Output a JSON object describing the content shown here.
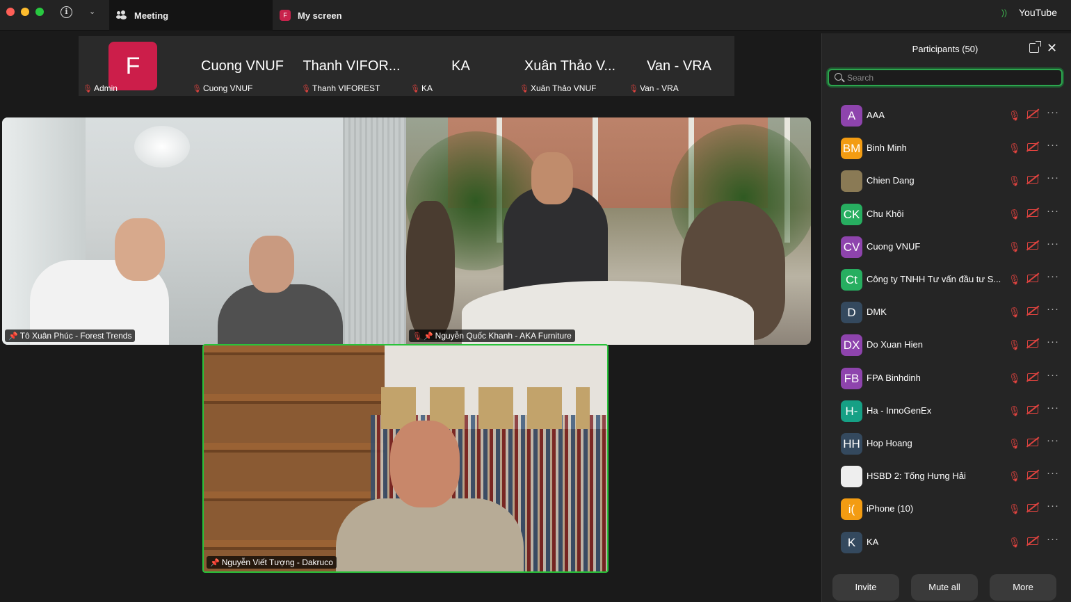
{
  "titlebar": {
    "tab_meeting": "Meeting",
    "tab_screen": "My screen",
    "tab_screen_badge": "F",
    "right_label": "YouTube"
  },
  "filmstrip": [
    {
      "big": "",
      "avatar": "F",
      "label": "Admin"
    },
    {
      "big": "Cuong VNUF",
      "label": "Cuong VNUF"
    },
    {
      "big": "Thanh VIFOR...",
      "label": "Thanh VIFOREST"
    },
    {
      "big": "KA",
      "label": "KA"
    },
    {
      "big": "Xuân Thảo V...",
      "label": "Xuân Thảo VNUF"
    },
    {
      "big": "Van - VRA",
      "label": "Van - VRA"
    }
  ],
  "tiles": {
    "t1": "Tô Xuân Phúc - Forest Trends",
    "t2": "Nguyễn Quốc Khanh - AKA Furniture",
    "t3": "Nguyễn Viết Tượng - Dakruco"
  },
  "panel": {
    "title": "Participants (50)",
    "search_placeholder": "Search",
    "participants": [
      {
        "initials": "A",
        "name": "AAA",
        "color": "#8e44ad"
      },
      {
        "initials": "BM",
        "name": "Binh Minh",
        "color": "#f39c12"
      },
      {
        "initials": "",
        "name": "Chien Dang",
        "color": "#8a7a55"
      },
      {
        "initials": "CK",
        "name": "Chu Khôi",
        "color": "#27ae60"
      },
      {
        "initials": "CV",
        "name": "Cuong VNUF",
        "color": "#8e44ad"
      },
      {
        "initials": "Ct",
        "name": "Công ty TNHH Tư vấn đầu tư S...",
        "color": "#27ae60"
      },
      {
        "initials": "D",
        "name": "DMK",
        "color": "#34495e"
      },
      {
        "initials": "DX",
        "name": "Do Xuan Hien",
        "color": "#8e44ad"
      },
      {
        "initials": "FB",
        "name": "FPA Binhdinh",
        "color": "#8e44ad"
      },
      {
        "initials": "H-",
        "name": "Ha - InnoGenEx",
        "color": "#16a085"
      },
      {
        "initials": "HH",
        "name": "Hop Hoang",
        "color": "#34495e"
      },
      {
        "initials": "",
        "name": "HSBD 2: Tống Hưng Hải",
        "color": "#eeeeee"
      },
      {
        "initials": "i(",
        "name": "iPhone (10)",
        "color": "#f39c12"
      },
      {
        "initials": "K",
        "name": "KA",
        "color": "#34495e"
      }
    ],
    "buttons": {
      "invite": "Invite",
      "mute_all": "Mute all",
      "more": "More"
    }
  },
  "colors": {
    "accent_green": "#29c33a",
    "muted_red": "#e0433f",
    "admin_avatar": "#cc1e4a"
  }
}
